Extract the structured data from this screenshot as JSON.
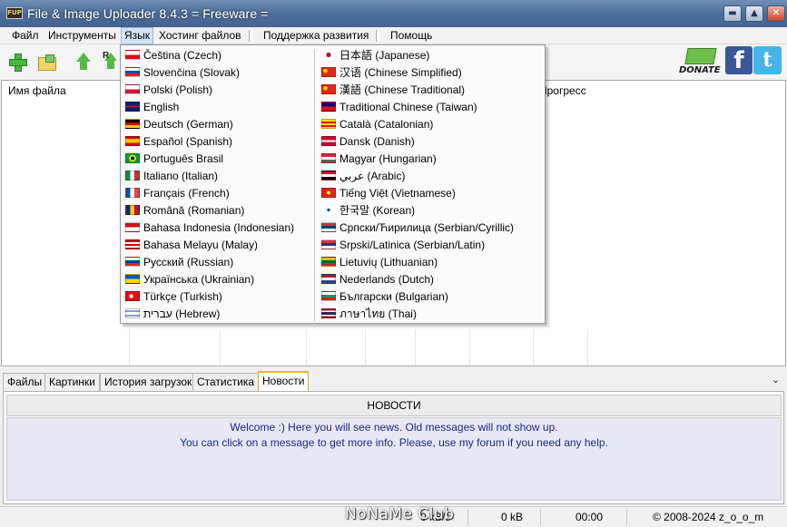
{
  "window": {
    "title": "File & Image Uploader 8.4.3  = Freeware =",
    "icon_text": "FUP"
  },
  "menu": [
    {
      "label": "Файл"
    },
    {
      "label": "Инструменты"
    },
    {
      "label": "Язык"
    },
    {
      "label": "Хостинг файлов"
    },
    {
      "label": "Поддержка развития"
    },
    {
      "label": "Помощь"
    }
  ],
  "toolbar": {
    "donate_label": "DONATE",
    "facebook_glyph": "f",
    "twitter_glyph": "t",
    "upload_r_label": "R"
  },
  "filelist": {
    "col_filename": "Имя файла",
    "col_progress": "Прогресс"
  },
  "languages_left": [
    {
      "label": "Čeština (Czech)"
    },
    {
      "label": "Slovenčina (Slovak)"
    },
    {
      "label": "Polski (Polish)"
    },
    {
      "label": "English"
    },
    {
      "label": "Deutsch (German)"
    },
    {
      "label": "Español (Spanish)"
    },
    {
      "label": "Português Brasil"
    },
    {
      "label": "Italiano (Italian)"
    },
    {
      "label": "Français (French)"
    },
    {
      "label": "Română (Romanian)"
    },
    {
      "label": "Bahasa Indonesia (Indonesian)"
    },
    {
      "label": "Bahasa Melayu (Malay)"
    },
    {
      "label": "Русский (Russian)"
    },
    {
      "label": "Українська (Ukrainian)"
    },
    {
      "label": "Türkçe (Turkish)"
    },
    {
      "label": "עברית (Hebrew)"
    }
  ],
  "languages_right": [
    {
      "label": "日本語 (Japanese)"
    },
    {
      "label": "汉语 (Chinese Simplified)"
    },
    {
      "label": "漢語 (Chinese Traditional)"
    },
    {
      "label": "Traditional Chinese (Taiwan)"
    },
    {
      "label": "Català (Catalonian)"
    },
    {
      "label": "Dansk (Danish)"
    },
    {
      "label": "Magyar (Hungarian)"
    },
    {
      "label": "عربي (Arabic)"
    },
    {
      "label": "Tiếng Việt (Vietnamese)"
    },
    {
      "label": "한국말 (Korean)"
    },
    {
      "label": "Српски/Ћирилица (Serbian/Cyrillic)"
    },
    {
      "label": "Srpski/Latinica (Serbian/Latin)"
    },
    {
      "label": "Lietuvių (Lithuanian)"
    },
    {
      "label": "Nederlands (Dutch)"
    },
    {
      "label": "Български (Bulgarian)"
    },
    {
      "label": "ภาษาไทย (Thai)"
    }
  ],
  "tabs": [
    {
      "label": "Файлы"
    },
    {
      "label": "Картинки"
    },
    {
      "label": "История загрузок"
    },
    {
      "label": "Статистика"
    },
    {
      "label": "Новости"
    }
  ],
  "news": {
    "header": "НОВОСТИ",
    "line1": "Welcome :) Here you will see news. Old messages will not show up.",
    "line2": "You can click on a message to get more info. Please, use my forum if you need any help."
  },
  "status": {
    "speed": "0 kB/s",
    "size": "0 kB",
    "time": "00:00",
    "copyright": "© 2008-2024 z_o_o_m"
  },
  "watermark": "NoNaMe Club",
  "colors": {
    "title_bar": "#4d6f9a",
    "news_text": "#1a2a8c",
    "active_tab_accent": "#f0b030"
  }
}
